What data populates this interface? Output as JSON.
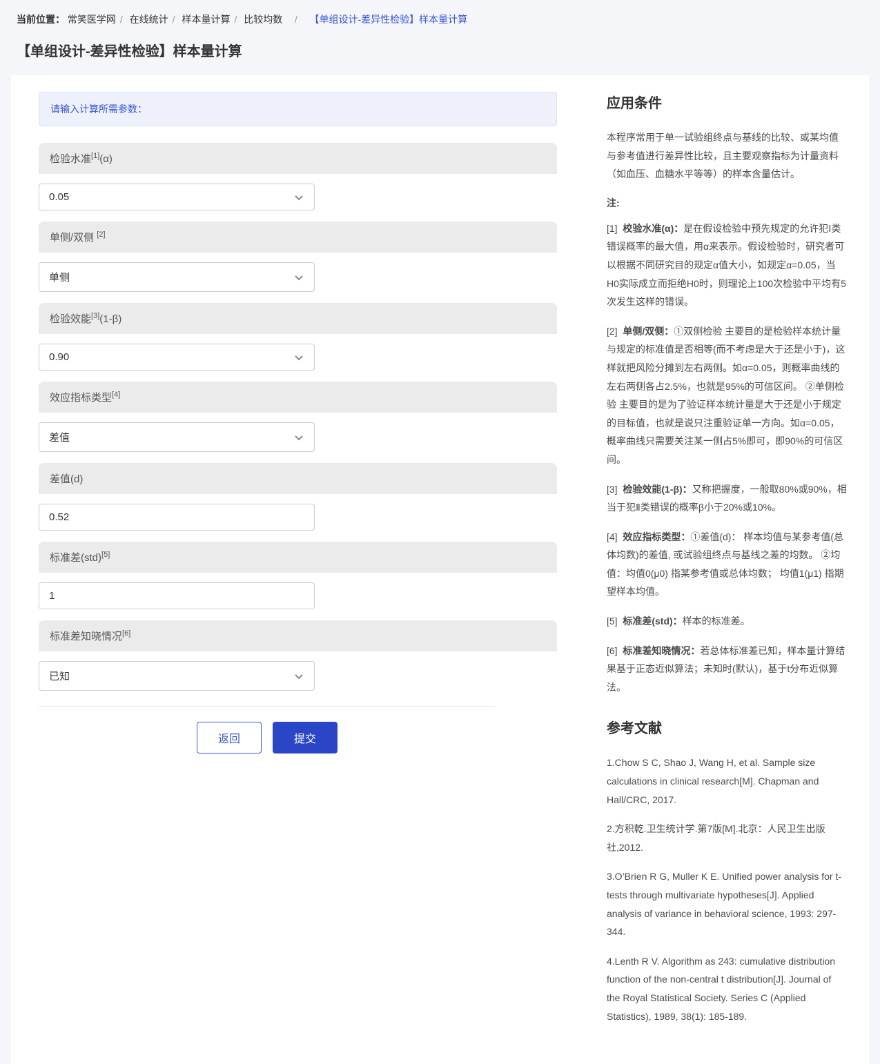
{
  "breadcrumb": {
    "prefix": "当前位置：",
    "items": [
      "常笑医学网",
      "在线统计",
      "样本量计算",
      "比较均数"
    ],
    "active": "【单组设计-差异性检验】样本量计算",
    "sep": "/"
  },
  "pageTitle": "【单组设计-差异性检验】样本量计算",
  "alertText": "请输入计算所需参数：",
  "fields": {
    "alpha": {
      "label_pre": "检验水准",
      "sup": "[1]",
      "label_post": "(α)",
      "value": "0.05"
    },
    "side": {
      "label_pre": "单侧/双侧 ",
      "sup": "[2]",
      "label_post": "",
      "value": "单侧"
    },
    "power": {
      "label_pre": "检验效能",
      "sup": "[3]",
      "label_post": "(1-β)",
      "value": "0.90"
    },
    "effectType": {
      "label_pre": "效应指标类型",
      "sup": "[4]",
      "label_post": "",
      "value": "差值"
    },
    "diff": {
      "label_pre": "差值(d)",
      "sup": "",
      "label_post": "",
      "value": "0.52"
    },
    "std": {
      "label_pre": "标准差(std)",
      "sup": "[5]",
      "label_post": "",
      "value": "1"
    },
    "stdKnown": {
      "label_pre": "标准差知晓情况",
      "sup": "[6]",
      "label_post": "",
      "value": "已知"
    }
  },
  "buttons": {
    "back": "返回",
    "submit": "提交"
  },
  "right": {
    "condTitle": "应用条件",
    "condText": "本程序常用于单一试验组终点与基线的比较、或某均值与参考值进行差异性比较，且主要观察指标为计量资料（如血压、血糖水平等等）的样本含量估计。",
    "noteLabel": "注:",
    "notes": [
      {
        "idx": "[1]",
        "bold": "校验水准(α)：",
        "text": "是在假设检验中预先规定的允许犯Ⅰ类错误概率的最大值，用α来表示。假设检验时，研究者可以根据不同研究目的规定α值大小，如规定α=0.05，当H0实际成立而拒绝H0时，则理论上100次检验中平均有5次发生这样的错误。"
      },
      {
        "idx": "[2]",
        "bold": "单侧/双侧：",
        "text": "①双侧检验 主要目的是检验样本统计量与规定的标准值是否相等(而不考虑是大于还是小于)，这样就把风险分摊到左右两侧。如α=0.05，则概率曲线的左右两侧各占2.5%，也就是95%的可信区间。 ②单侧检验 主要目的是为了验证样本统计量是大于还是小于规定的目标值，也就是说只注重验证单一方向。如α=0.05，概率曲线只需要关注某一侧占5%即可，即90%的可信区间。"
      },
      {
        "idx": "[3]",
        "bold": "检验效能(1-β)：",
        "text": "又称把握度，一般取80%或90%，相当于犯Ⅱ类错误的概率β小于20%或10%。"
      },
      {
        "idx": "[4]",
        "bold": "效应指标类型：",
        "text": "①差值(d)： 样本均值与某参考值(总体均数)的差值, 或试验组终点与基线之差的均数。 ②均值：均值0(μ0) 指某参考值或总体均数； 均值1(μ1) 指期望样本均值。"
      },
      {
        "idx": "[5]",
        "bold": "标准差(std)：",
        "text": "样本的标准差。"
      },
      {
        "idx": "[6]",
        "bold": "标准差知晓情况：",
        "text": "若总体标准差已知，样本量计算结果基于正态近似算法；未知时(默认)，基于t分布近似算法。"
      }
    ],
    "refTitle": "参考文献",
    "refs": [
      "1.Chow S C, Shao J, Wang H, et al. Sample size calculations in clinical research[M]. Chapman and Hall/CRC, 2017.",
      "2.方积乾.卫生统计学.第7版[M].北京：人民卫生出版社,2012.",
      "3.O’Brien R G, Muller K E. Unified power analysis for t-tests through multivariate hypotheses[J]. Applied analysis of variance in behavioral science, 1993: 297-344.",
      "4.Lenth R V. Algorithm as 243: cumulative distribution function of the non-central t distribution[J]. Journal of the Royal Statistical Society. Series C (Applied Statistics), 1989, 38(1): 185-189."
    ]
  }
}
